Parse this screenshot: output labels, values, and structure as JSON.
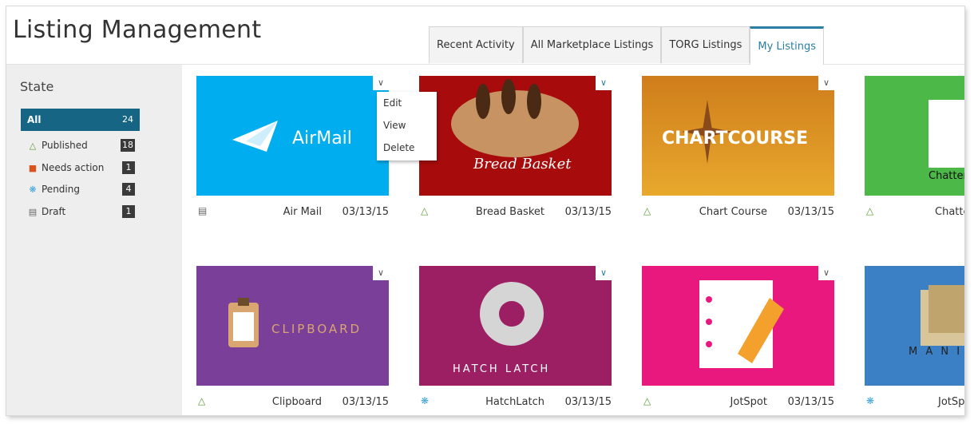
{
  "page": {
    "title": "Listing Management"
  },
  "tabs": [
    {
      "label": "Recent Activity"
    },
    {
      "label": "All Marketplace Listings"
    },
    {
      "label": "TORG Listings"
    },
    {
      "label": "My Listings"
    }
  ],
  "sidebar": {
    "heading": "State",
    "items": [
      {
        "label": "All",
        "count": "24",
        "icon": ""
      },
      {
        "label": "Published",
        "count": "18",
        "icon": "thumbs-up-icon"
      },
      {
        "label": "Needs action",
        "count": "1",
        "icon": "alert-icon"
      },
      {
        "label": "Pending",
        "count": "4",
        "icon": "spinner-icon"
      },
      {
        "label": "Draft",
        "count": "1",
        "icon": "document-icon"
      }
    ]
  },
  "listings": [
    {
      "name": "Air Mail",
      "date": "03/13/15",
      "status_icon": "document-icon",
      "thumb_text": "AirMail",
      "thumb_color": "#00aeef"
    },
    {
      "name": "Bread Basket",
      "date": "03/13/15",
      "status_icon": "thumbs-up-icon",
      "thumb_text": "Bread Basket",
      "thumb_color": "#a70b0b"
    },
    {
      "name": "Chart Course",
      "date": "03/13/15",
      "status_icon": "thumbs-up-icon",
      "thumb_text": "CHARTCOURSE",
      "thumb_color": "#e2951f"
    },
    {
      "name": "Chatter",
      "date": "",
      "status_icon": "thumbs-up-icon",
      "thumb_text": "Chatter",
      "thumb_color": "#4cb848"
    },
    {
      "name": "Clipboard",
      "date": "03/13/15",
      "status_icon": "thumbs-up-icon",
      "thumb_text": "CLIPBOARD",
      "thumb_color": "#7a3f98"
    },
    {
      "name": "HatchLatch",
      "date": "03/13/15",
      "status_icon": "spinner-icon",
      "thumb_text": "HATCH LATCH",
      "thumb_color": "#9c1f63"
    },
    {
      "name": "JotSpot",
      "date": "03/13/15",
      "status_icon": "thumbs-up-icon",
      "thumb_text": "",
      "thumb_color": "#e8187f"
    },
    {
      "name": "JotSp",
      "date": "",
      "status_icon": "spinner-icon",
      "thumb_text": "M A N I",
      "thumb_color": "#3b7fc4"
    }
  ],
  "context_menu": {
    "items": [
      {
        "label": "Edit"
      },
      {
        "label": "View"
      },
      {
        "label": "Delete"
      }
    ]
  }
}
